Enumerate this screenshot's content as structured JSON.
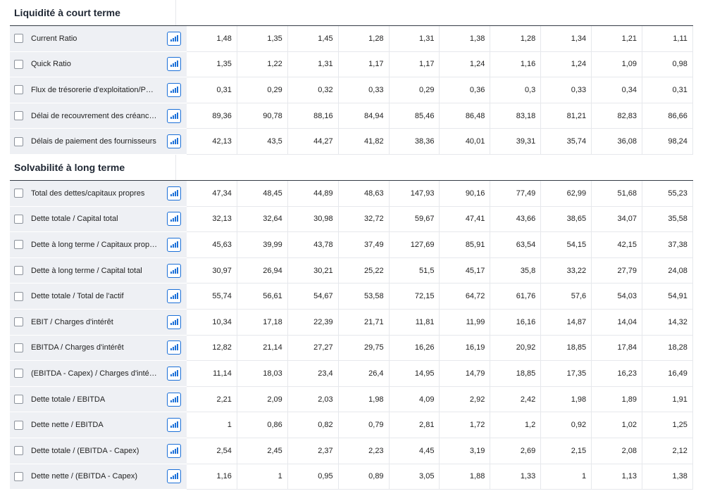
{
  "sections": [
    {
      "title": "Liquidité à court terme",
      "rows": [
        {
          "label": "Current Ratio",
          "values": [
            "1,48",
            "1,35",
            "1,45",
            "1,28",
            "1,31",
            "1,38",
            "1,28",
            "1,34",
            "1,21",
            "1,11"
          ]
        },
        {
          "label": "Quick Ratio",
          "values": [
            "1,35",
            "1,22",
            "1,31",
            "1,17",
            "1,17",
            "1,24",
            "1,16",
            "1,24",
            "1,09",
            "0,98"
          ]
        },
        {
          "label": "Flux de trésorerie d'exploitation/Pa…",
          "values": [
            "0,31",
            "0,29",
            "0,32",
            "0,33",
            "0,29",
            "0,36",
            "0,3",
            "0,33",
            "0,34",
            "0,31"
          ]
        },
        {
          "label": "Délai de recouvrement des créanc…",
          "values": [
            "89,36",
            "90,78",
            "88,16",
            "84,94",
            "85,46",
            "86,48",
            "83,18",
            "81,21",
            "82,83",
            "86,66"
          ]
        },
        {
          "label": "Délais de paiement des fournisseurs",
          "values": [
            "42,13",
            "43,5",
            "44,27",
            "41,82",
            "38,36",
            "40,01",
            "39,31",
            "35,74",
            "36,08",
            "98,24"
          ]
        }
      ]
    },
    {
      "title": "Solvabilité à long terme",
      "rows": [
        {
          "label": "Total des dettes/capitaux propres",
          "values": [
            "47,34",
            "48,45",
            "44,89",
            "48,63",
            "147,93",
            "90,16",
            "77,49",
            "62,99",
            "51,68",
            "55,23"
          ]
        },
        {
          "label": "Dette totale / Capital total",
          "values": [
            "32,13",
            "32,64",
            "30,98",
            "32,72",
            "59,67",
            "47,41",
            "43,66",
            "38,65",
            "34,07",
            "35,58"
          ]
        },
        {
          "label": "Dette à long terme / Capitaux prop…",
          "values": [
            "45,63",
            "39,99",
            "43,78",
            "37,49",
            "127,69",
            "85,91",
            "63,54",
            "54,15",
            "42,15",
            "37,38"
          ]
        },
        {
          "label": "Dette à long terme / Capital total",
          "values": [
            "30,97",
            "26,94",
            "30,21",
            "25,22",
            "51,5",
            "45,17",
            "35,8",
            "33,22",
            "27,79",
            "24,08"
          ]
        },
        {
          "label": "Dette totale / Total de l'actif",
          "values": [
            "55,74",
            "56,61",
            "54,67",
            "53,58",
            "72,15",
            "64,72",
            "61,76",
            "57,6",
            "54,03",
            "54,91"
          ]
        },
        {
          "label": "EBIT / Charges d'intérêt",
          "values": [
            "10,34",
            "17,18",
            "22,39",
            "21,71",
            "11,81",
            "11,99",
            "16,16",
            "14,87",
            "14,04",
            "14,32"
          ]
        },
        {
          "label": "EBITDA / Charges d'intérêt",
          "values": [
            "12,82",
            "21,14",
            "27,27",
            "29,75",
            "16,26",
            "16,19",
            "20,92",
            "18,85",
            "17,84",
            "18,28"
          ]
        },
        {
          "label": "(EBITDA - Capex) / Charges d'intérêt",
          "values": [
            "11,14",
            "18,03",
            "23,4",
            "26,4",
            "14,95",
            "14,79",
            "18,85",
            "17,35",
            "16,23",
            "16,49"
          ]
        },
        {
          "label": "Dette totale / EBITDA",
          "values": [
            "2,21",
            "2,09",
            "2,03",
            "1,98",
            "4,09",
            "2,92",
            "2,42",
            "1,98",
            "1,89",
            "1,91"
          ]
        },
        {
          "label": "Dette nette / EBITDA",
          "values": [
            "1",
            "0,86",
            "0,82",
            "0,79",
            "2,81",
            "1,72",
            "1,2",
            "0,92",
            "1,02",
            "1,25"
          ]
        },
        {
          "label": "Dette totale / (EBITDA - Capex)",
          "values": [
            "2,54",
            "2,45",
            "2,37",
            "2,23",
            "4,45",
            "3,19",
            "2,69",
            "2,15",
            "2,08",
            "2,12"
          ]
        },
        {
          "label": "Dette nette / (EBITDA - Capex)",
          "values": [
            "1,16",
            "1",
            "0,95",
            "0,89",
            "3,05",
            "1,88",
            "1,33",
            "1",
            "1,13",
            "1,38"
          ]
        }
      ]
    }
  ],
  "icons": {
    "row_checkbox": "checkbox-icon",
    "row_chart_button": "bar-chart-icon"
  },
  "colors": {
    "accent": "#1a6fd8",
    "label_bg": "#eef0f4"
  }
}
